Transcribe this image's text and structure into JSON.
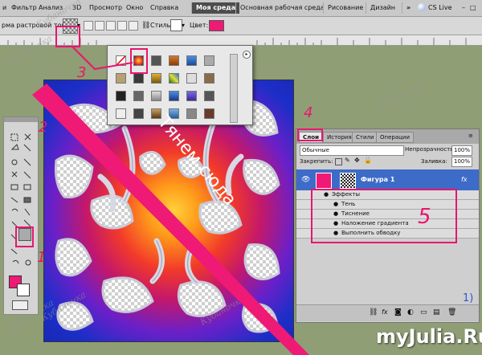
{
  "menu": {
    "items": [
      "и",
      "Фильтр",
      "Анализ",
      "3D",
      "Просмотр",
      "Окно",
      "Справка"
    ],
    "workspaces": [
      "Моя среда",
      "Основная рабочая среда",
      "Рисование",
      "Дизайн"
    ],
    "overflow": "»",
    "cs_live": "CS Live"
  },
  "options": {
    "mode_label": "рма растровой точки",
    "style_label": "Стиль:",
    "color_label": "Цвет:",
    "color_value": "#ee1a75"
  },
  "layers": {
    "tabs": [
      "Слои",
      "История",
      "Стили",
      "Операции"
    ],
    "blend_mode": "Обычные",
    "opacity_label": "Непрозрачность:",
    "opacity_value": "100%",
    "lock_label": "Закрепить:",
    "fill_label": "Заливка:",
    "fill_value": "100%",
    "layer_name": "Фигура 1",
    "fx_label": "fx",
    "effects_label": "Эффекты",
    "effects": [
      "Тень",
      "Тиснение",
      "Наложение градиента",
      "Выполнить обводку"
    ]
  },
  "annotations": {
    "drag_here": "Тянем сюда",
    "num_1": "1",
    "num_2": "2",
    "num_3": "3",
    "num_4": "4",
    "num_5": "5",
    "corner": "1)"
  },
  "watermark": {
    "text": "Кубаночка",
    "site": "myJulia.Ru"
  },
  "colors": {
    "accent_pink": "#ee1a75",
    "annotation": "#e8166f",
    "foreground": "#ee1a75",
    "background": "#ffffff"
  }
}
